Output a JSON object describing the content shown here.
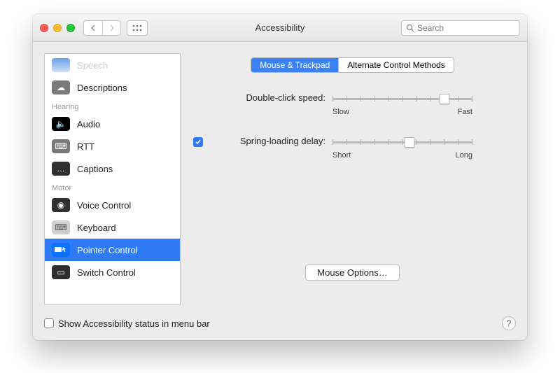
{
  "window": {
    "title": "Accessibility"
  },
  "toolbar": {
    "search_placeholder": "Search"
  },
  "sidebar": {
    "top_partial": "Speech",
    "items_pre_hearing": [
      {
        "label": "Descriptions",
        "icon": "descriptions-icon"
      }
    ],
    "section_hearing": "Hearing",
    "items_hearing": [
      {
        "label": "Audio",
        "icon": "audio-icon"
      },
      {
        "label": "RTT",
        "icon": "rtt-icon"
      },
      {
        "label": "Captions",
        "icon": "captions-icon"
      }
    ],
    "section_motor": "Motor",
    "items_motor": [
      {
        "label": "Voice Control",
        "icon": "voice-control-icon"
      },
      {
        "label": "Keyboard",
        "icon": "keyboard-icon"
      },
      {
        "label": "Pointer Control",
        "icon": "pointer-control-icon",
        "selected": true
      },
      {
        "label": "Switch Control",
        "icon": "switch-control-icon"
      }
    ]
  },
  "tabs": {
    "mouse_trackpad": "Mouse & Trackpad",
    "alternate": "Alternate Control Methods",
    "active": "mouse_trackpad"
  },
  "controls": {
    "double_click_label": "Double-click speed:",
    "double_click_min": "Slow",
    "double_click_max": "Fast",
    "double_click_value_pct": 80,
    "spring_loading_label": "Spring-loading delay:",
    "spring_loading_checked": true,
    "spring_loading_min": "Short",
    "spring_loading_max": "Long",
    "spring_loading_value_pct": 55,
    "mouse_options_button": "Mouse Options…"
  },
  "footer": {
    "show_status_label": "Show Accessibility status in menu bar",
    "show_status_checked": false
  }
}
